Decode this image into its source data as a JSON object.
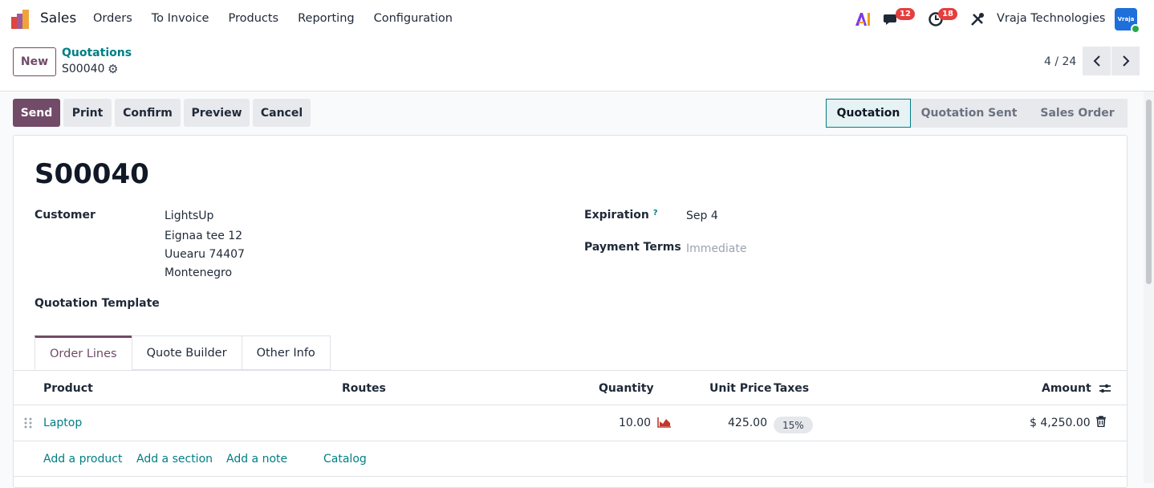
{
  "navbar": {
    "app_name": "Sales",
    "menu": [
      "Orders",
      "To Invoice",
      "Products",
      "Reporting",
      "Configuration"
    ],
    "ai_label": "AI",
    "messages_count": "12",
    "activities_count": "18",
    "company": "Vraja Technologies",
    "avatar_text": "Vraja"
  },
  "control": {
    "new_label": "New",
    "breadcrumb_parent": "Quotations",
    "breadcrumb_current": "S00040",
    "pager": "4 / 24"
  },
  "actions": {
    "send": "Send",
    "print": "Print",
    "confirm": "Confirm",
    "preview": "Preview",
    "cancel": "Cancel"
  },
  "status": [
    "Quotation",
    "Quotation Sent",
    "Sales Order"
  ],
  "form": {
    "title": "S00040",
    "customer_label": "Customer",
    "customer_lines": [
      "LightsUp",
      "Eignaa tee 12",
      "Uuearu 74407",
      "Montenegro"
    ],
    "template_label": "Quotation Template",
    "expiration_label": "Expiration",
    "expiration_help": "?",
    "expiration_value": "Sep 4",
    "payment_terms_label": "Payment Terms",
    "payment_terms_placeholder": "Immediate"
  },
  "tabs": [
    "Order Lines",
    "Quote Builder",
    "Other Info"
  ],
  "table": {
    "headers": {
      "product": "Product",
      "routes": "Routes",
      "quantity": "Quantity",
      "unit_price": "Unit Price",
      "taxes": "Taxes",
      "amount": "Amount"
    },
    "rows": [
      {
        "product": "Laptop",
        "quantity": "10.00",
        "unit_price": "425.00",
        "tax": "15%",
        "amount": "$ 4,250.00"
      }
    ],
    "add_links": [
      "Add a product",
      "Add a section",
      "Add a note",
      "Catalog"
    ]
  },
  "colors": {
    "brand": "#714b67",
    "link": "#017e84",
    "badge": "#e53e3e"
  }
}
